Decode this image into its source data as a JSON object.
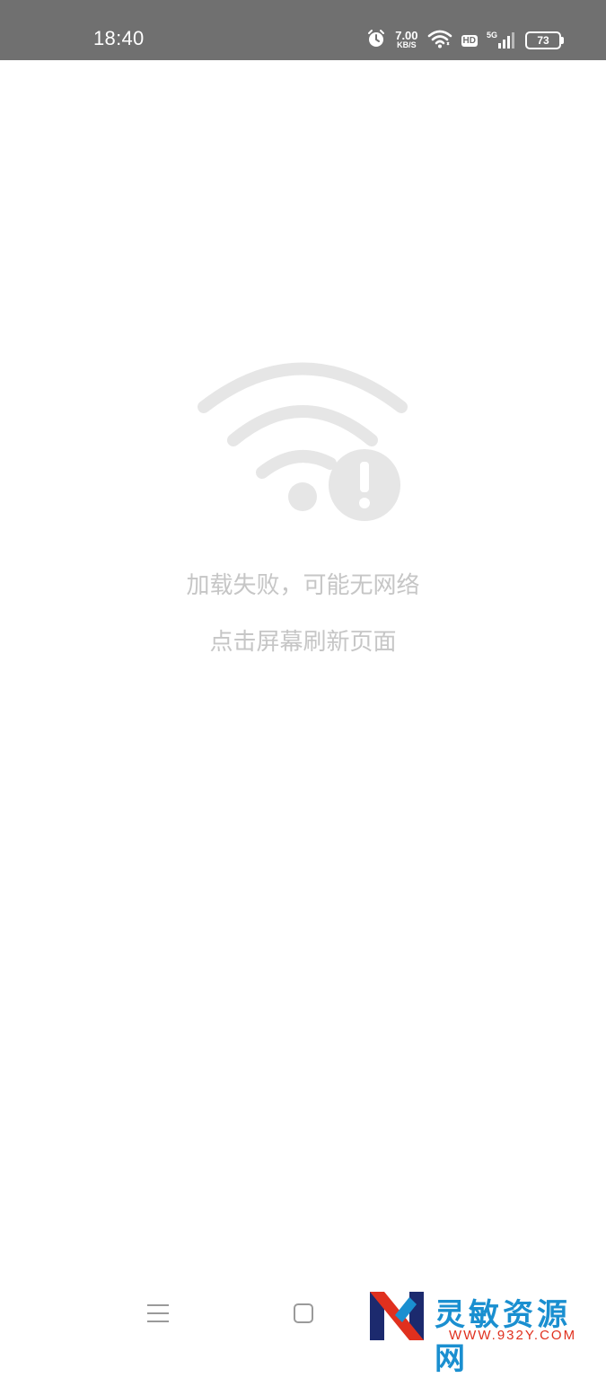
{
  "status_bar": {
    "time": "18:40",
    "net_speed_value": "7.00",
    "net_speed_unit": "KB/S",
    "hd_label": "HD",
    "network_gen": "5G",
    "battery_level": "73",
    "icons": [
      "alarm-icon",
      "wifi-icon",
      "hd-icon",
      "cellular-signal-icon",
      "battery-icon"
    ]
  },
  "error_screen": {
    "icon": "wifi-error-icon",
    "message": "加载失败，可能无网络",
    "hint": "点击屏幕刷新页面",
    "color": "#c6c6c6",
    "icon_color": "#e6e6e6"
  },
  "nav_bar": {
    "icons": [
      "menu-icon",
      "home-icon"
    ]
  },
  "watermark": {
    "title": "灵敏资源网",
    "url": "WWW.932Y.COM",
    "colors": {
      "blue": "#1a8fd0",
      "red": "#e0301e",
      "navy": "#1c2a6e"
    }
  },
  "colors": {
    "status_bar_bg": "#707070",
    "page_bg": "#ffffff"
  }
}
